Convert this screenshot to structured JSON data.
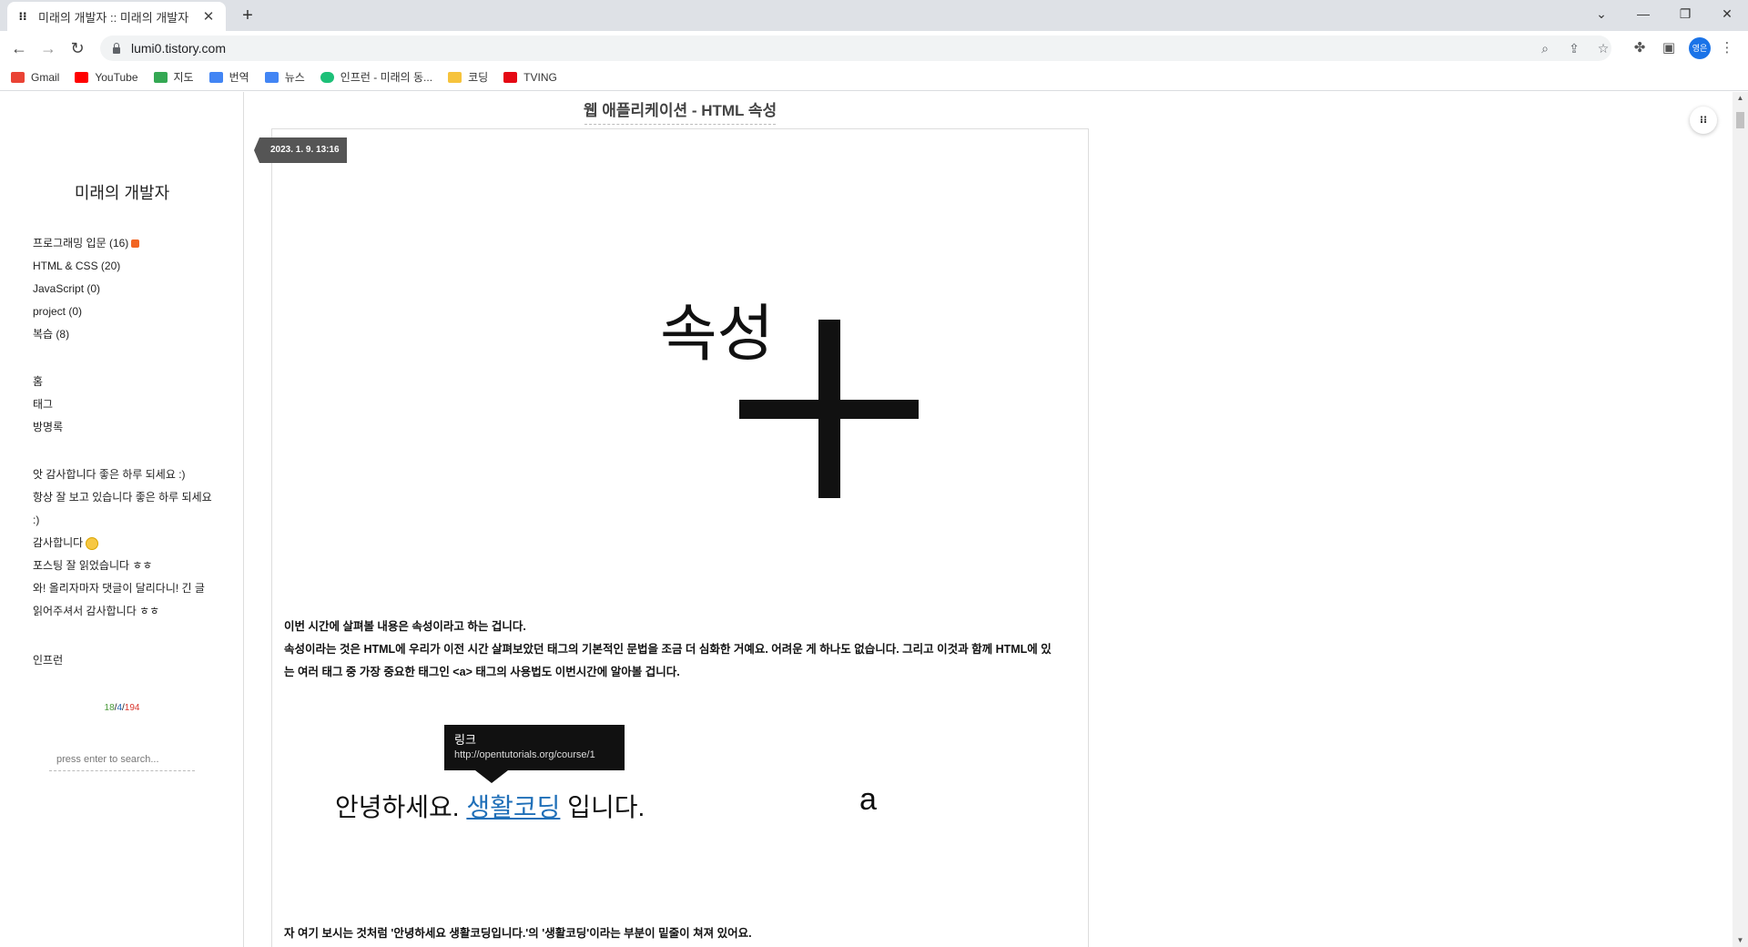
{
  "browser": {
    "tab_title": "미래의 개발자 :: 미래의 개발자",
    "tab_close": "✕",
    "new_tab": "+",
    "url": "lumi0.tistory.com",
    "profile_label": "영은",
    "window_controls": {
      "dropdown": "⌄",
      "minimize": "—",
      "restore": "❐",
      "close": "✕"
    },
    "bookmarks": [
      {
        "label": "Gmail",
        "color": "#ea4335"
      },
      {
        "label": "YouTube",
        "color": "#ff0000"
      },
      {
        "label": "지도",
        "color": "#34a853"
      },
      {
        "label": "번역",
        "color": "#4285f4"
      },
      {
        "label": "뉴스",
        "color": "#4285f4"
      },
      {
        "label": "인프런 - 미래의 동...",
        "color": "#1dc078"
      },
      {
        "label": "코딩",
        "color": "#f6c33c"
      },
      {
        "label": "TVING",
        "color": "#e50914"
      }
    ]
  },
  "sidebar": {
    "blog_title": "미래의 개발자",
    "categories": [
      {
        "label": "프로그래밍 입문 (16)",
        "new": true
      },
      {
        "label": "HTML & CSS (20)"
      },
      {
        "label": "JavaScript (0)"
      },
      {
        "label": "project (0)"
      },
      {
        "label": "복습 (8)"
      }
    ],
    "menu": [
      "홈",
      "태그",
      "방명록"
    ],
    "recent_comments": [
      "앗 감사합니다 좋은 하루 되세요 :)",
      "항상 잘 보고 있습니다 좋은 하루 되세요",
      ":)",
      "감사합니다",
      "포스팅 잘 읽었습니다 ㅎㅎ",
      "와! 올리자마자 댓글이 달리다니! 긴 글",
      "읽어주셔서 감사합니다 ㅎㅎ"
    ],
    "link": "인프런",
    "counter": {
      "total": "18",
      "today": "4",
      "yesterday": "194",
      "sep": "/"
    },
    "search_placeholder": "press enter to search..."
  },
  "post": {
    "title": "웹 애플리케이션 - HTML 속성",
    "date": "2023. 1. 9. 13:16",
    "hero_word": "속성",
    "intro": [
      "이번 시간에 살펴볼 내용은 속성이라고 하는 겁니다.",
      "속성이라는 것은 HTML에 우리가 이전 시간 살펴보았던 태그의 기본적인 문법을 조금 더 심화한 거예요. 어려운 게 하나도 없습니다. 그리고 이것과 함께 HTML에 있",
      "는 여러 태그 중 가장 중요한 태그인 <a> 태그의 사용법도 이번시간에 알아볼 겁니다."
    ],
    "tooltip": {
      "title": "링크",
      "url": "http://opentutorials.org/course/1"
    },
    "sample": {
      "before": "안녕하세요. ",
      "link": "생활코딩",
      "after": " 입니다."
    },
    "letter": "a",
    "footer_para": "자 여기 보시는 것처럼 '안녕하세요 생활코딩입니다.'의 '생활코딩'이라는 부분이 밑줄이 쳐져 있어요."
  },
  "colors": {
    "link": "#1f6fb8",
    "counter_total": "#4a9a3a",
    "counter_today": "#1a5fb4",
    "counter_yesterday": "#d9342b"
  }
}
